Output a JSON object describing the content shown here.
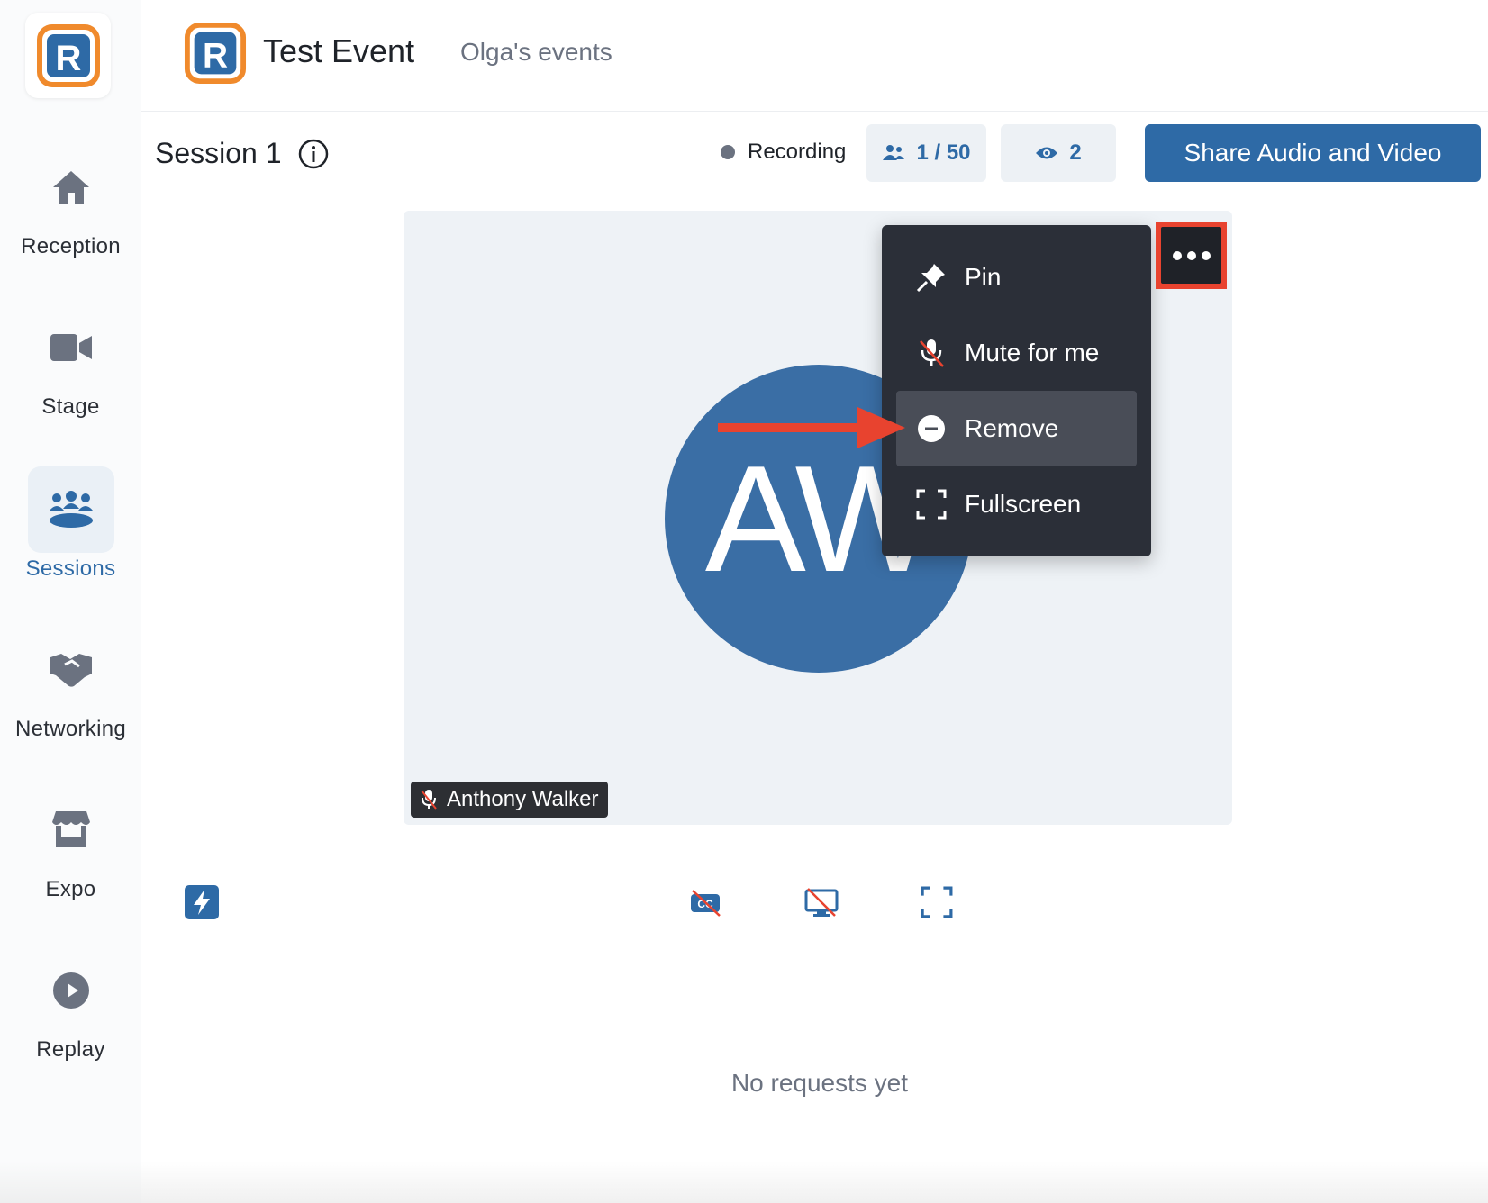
{
  "sidebar": {
    "logo_letter": "R",
    "items": [
      {
        "label": "Reception",
        "icon": "home-icon"
      },
      {
        "label": "Stage",
        "icon": "video-camera-icon"
      },
      {
        "label": "Sessions",
        "icon": "people-table-icon",
        "active": true
      },
      {
        "label": "Networking",
        "icon": "handshake-icon"
      },
      {
        "label": "Expo",
        "icon": "booth-icon"
      },
      {
        "label": "Replay",
        "icon": "play-circle-icon"
      }
    ]
  },
  "header": {
    "event_logo_letter": "R",
    "event_title": "Test Event",
    "org_name": "Olga's events"
  },
  "session": {
    "title": "Session 1",
    "recording_label": "Recording",
    "participants": "1 / 50",
    "viewers": "2",
    "share_button": "Share Audio and Video"
  },
  "video": {
    "avatar_initials": "AW",
    "participant_name": "Anthony Walker"
  },
  "menu": {
    "items": [
      {
        "label": "Pin",
        "icon": "pin-icon"
      },
      {
        "label": "Mute for me",
        "icon": "mic-muted-icon"
      },
      {
        "label": "Remove",
        "icon": "minus-circle-icon",
        "highlighted": true
      },
      {
        "label": "Fullscreen",
        "icon": "fullscreen-icon"
      }
    ]
  },
  "bottom": {
    "no_requests": "No requests yet"
  },
  "colors": {
    "brand_blue": "#2e6aa6",
    "logo_orange": "#f08a2c",
    "annotation_red": "#e8432f",
    "menu_bg": "#2b2f38"
  }
}
